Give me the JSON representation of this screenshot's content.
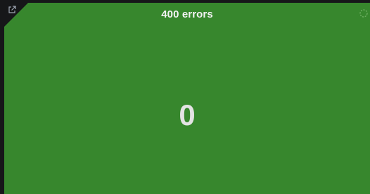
{
  "panel": {
    "title": "400 errors",
    "value": "0",
    "background_color": "#37872d",
    "corner_icon": "external-link-icon",
    "status_icon": "loading-spinner-icon"
  }
}
